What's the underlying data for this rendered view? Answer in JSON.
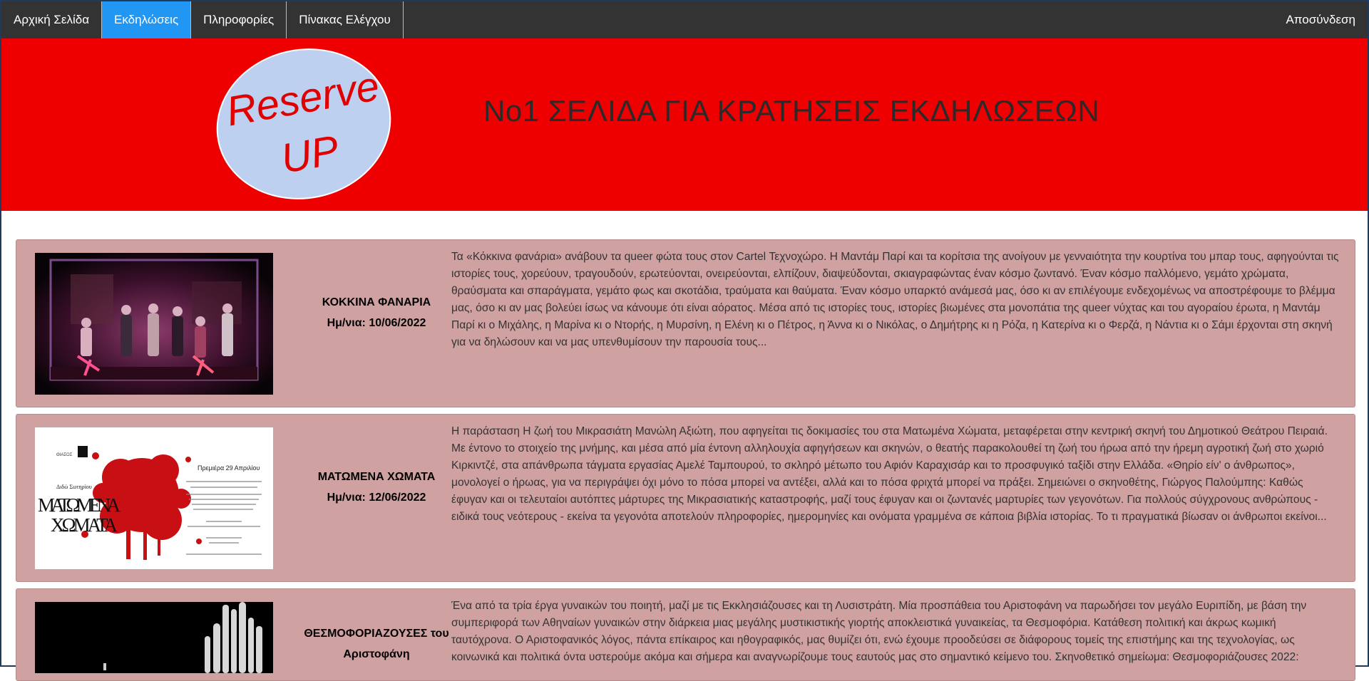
{
  "nav": {
    "items": [
      {
        "label": "Αρχική Σελίδα"
      },
      {
        "label": "Εκδηλώσεις"
      },
      {
        "label": "Πληροφορίες"
      },
      {
        "label": "Πίνακας Ελέγχου"
      }
    ],
    "logout_label": "Αποσύνδεση"
  },
  "banner": {
    "logo_line1": "Reserve",
    "logo_line2": "UP",
    "title": "No1 ΣΕΛΙΔΑ ΓΙΑ ΚΡΑΤΗΣΕΙΣ ΕΚΔΗΛΩΣΕΩΝ"
  },
  "events": [
    {
      "title": "ΚΟΚΚΙΝΑ ΦΑΝΑΡΙΑ",
      "date": "Ημ/νια: 10/06/2022",
      "description": "Τα «Κόκκινα φανάρια» ανάβουν τα queer φώτα τους στον Cartel Τεχνοχώρο. Η Μαντάμ Παρί και τα κορίτσια της ανοίγουν με γενναιότητα την κουρτίνα του μπαρ τους, αφηγούνται τις ιστορίες τους, χορεύουν, τραγουδούν, ερωτεύονται, ονειρεύονται, ελπίζουν, διαψεύδονται, σκιαγραφώντας έναν κόσμο ζωντανό. Έναν κόσμο παλλόμενο, γεμάτο χρώματα, θραύσματα και σπαράγματα, γεμάτο φως και σκοτάδια, τραύματα και θαύματα. Έναν κόσμο υπαρκτό ανάμεσά μας, όσο κι αν επιλέγουμε ενδεχομένως να αποστρέφουμε το βλέμμα μας, όσο κι αν μας βολεύει ίσως να κάνουμε ότι είναι αόρατος. Μέσα από τις ιστορίες τους, ιστορίες βιωμένες στα μονοπάτια της queer νύχτας και του αγοραίου έρωτα, η Μαντάμ Παρί κι ο Μιχάλης, η Μαρίνα κι ο Ντορής, η Μυρσίνη, η Ελένη κι ο Πέτρος, η Άννα κι ο Νικόλας, ο Δημήτρης κι η Ρόζα, η Κατερίνα κι ο Φερζά, η Νάντια κι ο Σάμι έρχονται στη σκηνή για να δηλώσουν και να μας υπενθυμίσουν την παρουσία τους..."
    },
    {
      "title": "ΜΑΤΩΜΕΝΑ ΧΩΜΑΤΑ",
      "date": "Ημ/νια: 12/06/2022",
      "description": "Η παράσταση Η ζωή του Μικρασιάτη Μανώλη Αξιώτη, που αφηγείται τις δοκιμασίες του στα Ματωμένα Χώματα, μεταφέρεται στην κεντρική σκηνή του Δημοτικού Θεάτρου Πειραιά. Με έντονο το στοιχείο της μνήμης, και μέσα από μία έντονη αλληλουχία αφηγήσεων και σκηνών, ο θεατής παρακολουθεί τη ζωή του ήρωα από την ήρεμη αγροτική ζωή στο χωριό Κιρκιντζέ, στα απάνθρωπα τάγματα εργασίας Αμελέ Ταμπουρού, το σκληρό μέτωπο του Αφιόν Καραχισάρ και το προσφυγικό ταξίδι στην Ελλάδα. «Θηρίο είν' ο άνθρωπος», μονολογεί ο ήρωας, για να περιγράψει όχι μόνο το πόσα μπορεί να αντέξει, αλλά και το πόσα φριχτά μπορεί να πράξει. Σημειώνει ο σκηνοθέτης, Γιώργος Παλούμπης: Καθώς έφυγαν και οι τελευταίοι αυτόπτες μάρτυρες της Μικρασιατικής καταστροφής, μαζί τους έφυγαν και οι ζωντανές μαρτυρίες των γεγονότων. Για πολλούς σύγχρονους ανθρώπους - ειδικά τους νεότερους - εκείνα τα γεγονότα αποτελούν πληροφορίες, ημερομηνίες και ονόματα γραμμένα σε κάποια βιβλία ιστορίας. Το τι πραγματικά βίωσαν οι άνθρωποι εκείνοι...",
      "poster": {
        "company": "ΘΙΑΣΟΣ",
        "author": "Διδώ Σωτηρίου",
        "title_line1": "ΜΑΤΩΜΕΝΑ",
        "title_line2": "ΧΩΜΑΤΑ",
        "premiere": "Πρεμιέρα 29 Απριλίου"
      }
    },
    {
      "title": "ΘΕΣΜΟΦΟΡΙΑΖΟΥΣΕΣ του Αριστοφάνη",
      "date": "",
      "description": "Ένα από τα τρία έργα γυναικών του ποιητή, μαζί με τις Εκκλησιάζουσες και τη Λυσιστράτη. Μία προσπάθεια του Αριστοφάνη να παρωδήσει τον μεγάλο Ευριπίδη, με βάση την συμπεριφορά των Αθηναίων γυναικών στην διάρκεια μιας μεγάλης μυστικιστικής γιορτής αποκλειστικά γυναικείας, τα Θεσμοφόρια. Κατάθεση πολιτική και άκρως κωμική ταυτόχρονα. Ο Αριστοφανικός λόγος, πάντα επίκαιρος και ηθογραφικός, μας θυμίζει ότι, ενώ έχουμε προοδεύσει σε διάφορους τομείς της επιστήμης και της τεχνολογίας, ως κοινωνικά και πολιτικά όντα υστερούμε ακόμα και σήμερα και αναγνωρίζουμε τους εαυτούς μας στο σημαντικό κείμενο του. Σκηνοθετικό σημείωμα: Θεσμοφοριάζουσες 2022:"
    }
  ]
}
